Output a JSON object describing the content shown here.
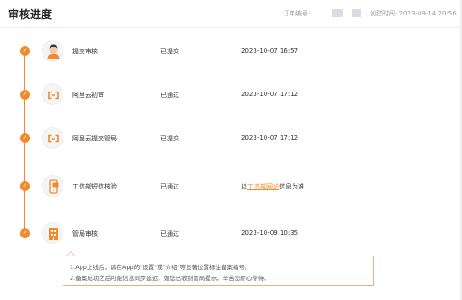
{
  "header": {
    "title": "审核进度",
    "order_label": "订单编号:",
    "created_label": "创建时间: 2023-09-14 20:56"
  },
  "steps": [
    {
      "name": "提交审核",
      "status": "已提交",
      "time": "2023-10-07 16:57",
      "icon": "person-avatar-icon"
    },
    {
      "name": "阿里云初审",
      "status": "已通过",
      "time": "2023-10-07 17:12",
      "icon": "aliyun-logo-icon"
    },
    {
      "name": "阿里云提交管局",
      "status": "已提交",
      "time": "2023-10-07 17:12",
      "icon": "aliyun-logo-icon"
    },
    {
      "name": "工信部短信核验",
      "status": "已通过",
      "time_prefix": "以",
      "time_link": "工信部网站",
      "time_suffix": "信息为准",
      "icon": "phone-sms-icon"
    },
    {
      "name": "管局审核",
      "status": "已通过",
      "time": "2023-10-09 10:35",
      "icon": "building-icon"
    }
  ],
  "tip": {
    "line1": "1.App上线后，请在App的\"设置\"或\"介绍\"等显著位置标注备案编号。",
    "line2": "2.备案成功之后可能信息同步延迟，如您已收到管局提示，辛苦您耐心等待。"
  },
  "colors": {
    "accent": "#f08a2b",
    "border": "#f3b07a"
  }
}
